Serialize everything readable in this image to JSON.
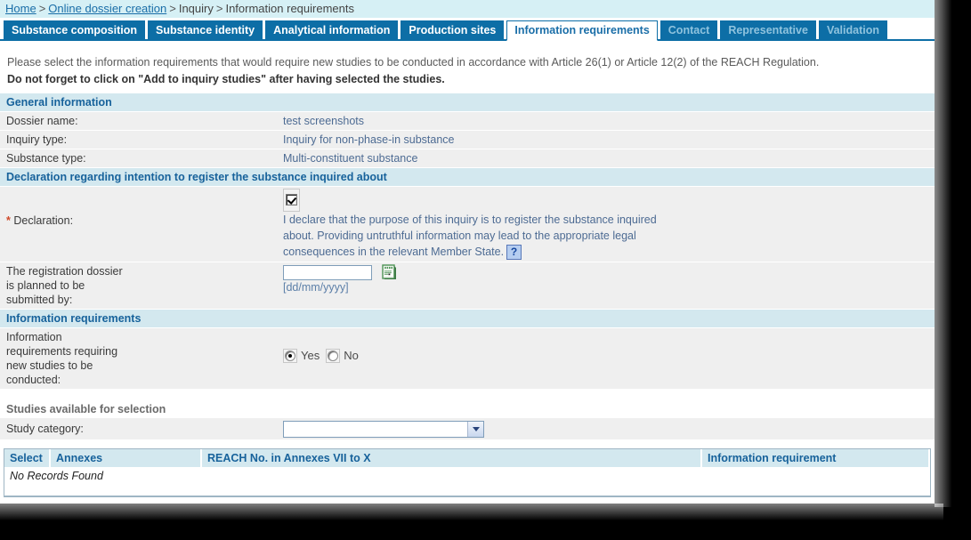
{
  "breadcrumb": {
    "items": [
      {
        "label": "Home",
        "link": true
      },
      {
        "label": "Online dossier creation",
        "link": true
      },
      {
        "label": "Inquiry",
        "link": false
      },
      {
        "label": "Information requirements",
        "link": false
      }
    ],
    "separator": ">"
  },
  "tabs": [
    {
      "label": "Substance composition",
      "state": "normal"
    },
    {
      "label": "Substance identity",
      "state": "normal"
    },
    {
      "label": "Analytical information",
      "state": "normal"
    },
    {
      "label": "Production sites",
      "state": "normal"
    },
    {
      "label": "Information requirements",
      "state": "active"
    },
    {
      "label": "Contact",
      "state": "muted"
    },
    {
      "label": "Representative",
      "state": "muted"
    },
    {
      "label": "Validation",
      "state": "muted"
    }
  ],
  "intro": {
    "line1": "Please select the information requirements that would require new studies to be conducted in accordance with Article 26(1) or Article 12(2) of the REACH Regulation.",
    "line2": "Do not forget to click on \"Add to inquiry studies\" after having selected the studies."
  },
  "general_information": {
    "title": "General information",
    "rows": [
      {
        "label": "Dossier name:",
        "value": "test screenshots"
      },
      {
        "label": "Inquiry type:",
        "value": "Inquiry for non-phase-in substance"
      },
      {
        "label": "Substance type:",
        "value": "Multi-constituent substance"
      }
    ]
  },
  "declaration": {
    "title": "Declaration regarding intention to register the substance inquired about",
    "required_marker": "*",
    "label": "Declaration:",
    "checkbox_checked": true,
    "text": "I declare that the purpose of this inquiry is to register the substance inquired about. Providing untruthful information may lead to the appropriate legal consequences in the relevant Member State.",
    "help_label": "?"
  },
  "submission": {
    "label_line1": "The registration dossier",
    "label_line2": "is planned to be",
    "label_line3": "submitted by:",
    "value": "",
    "placeholder": "",
    "format_hint": "[dd/mm/yyyy]",
    "calendar_icon": "calendar-icon"
  },
  "information_requirements": {
    "title": "Information requirements",
    "label_line1": "Information",
    "label_line2": "requirements requiring",
    "label_line3": "new studies to be",
    "label_line4": "conducted:",
    "options": [
      {
        "label": "Yes",
        "selected": true
      },
      {
        "label": "No",
        "selected": false
      }
    ]
  },
  "studies": {
    "title": "Studies available for selection",
    "category_label": "Study category:",
    "category_value": "",
    "category_placeholder": ""
  },
  "results_table": {
    "columns": [
      "Select",
      "Annexes",
      "REACH No. in Annexes VII to X",
      "Information requirement"
    ],
    "empty_message": "No Records Found",
    "rows": []
  },
  "colors": {
    "tab_blue": "#0d6ea6",
    "breadcrumb_bg": "#d6f0f5",
    "section_header_bg": "#d3e8ef",
    "section_header_text": "#17629b",
    "row_bg": "#efefef",
    "value_text": "#4d6b93",
    "required_star": "#d04a2a",
    "calendar_green": "#4f9457"
  }
}
